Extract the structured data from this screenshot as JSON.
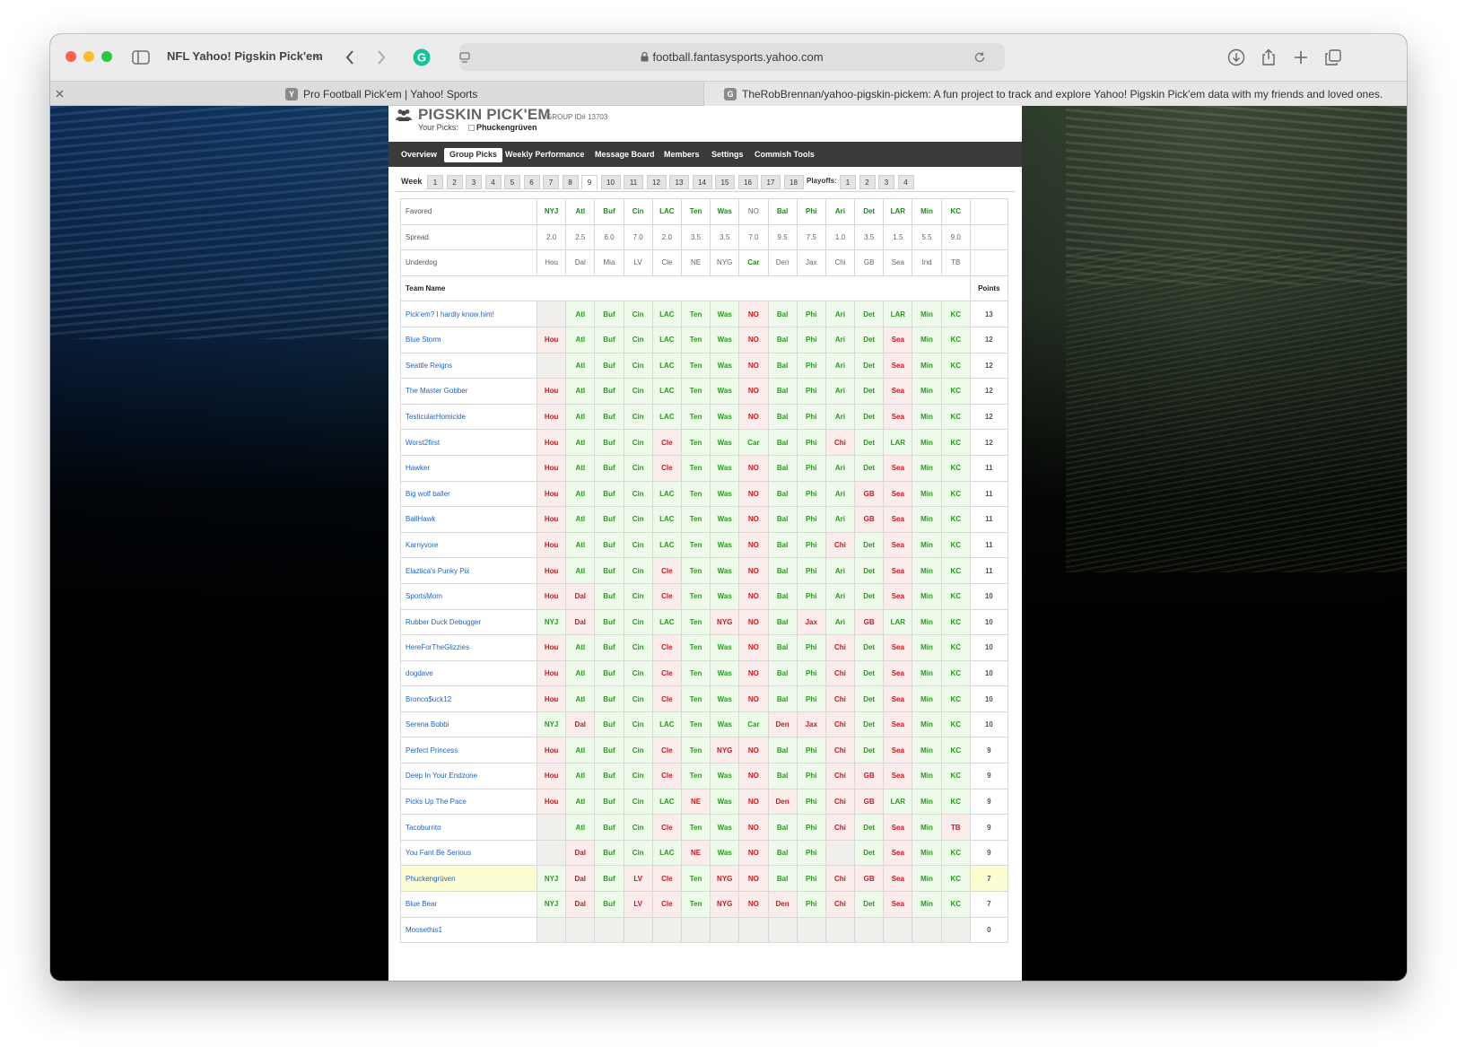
{
  "browser": {
    "window_title": "NFL Yahoo! Pigskin Pick'em",
    "url": "football.fantasysports.yahoo.com",
    "tabs": [
      {
        "favicon": "Y",
        "label": "Pro Football Pick'em | Yahoo! Sports"
      },
      {
        "favicon": "G",
        "label": "TheRobBrennan/yahoo-pigskin-pickem: A fun project to track and explore Yahoo! Pigskin Pick'em data with my friends and loved ones."
      }
    ]
  },
  "header": {
    "brand": "PIGSKIN PICK'EM",
    "group_id": "GROUP ID# 13703",
    "your_picks_label": "Your Picks:",
    "your_picks_value": "Phuckengrüven"
  },
  "nav": [
    "Overview",
    "Group Picks",
    "Weekly Performance",
    "Message Board",
    "Members",
    "Settings",
    "Commish Tools"
  ],
  "nav_active": "Group Picks",
  "weeks": {
    "label": "Week",
    "items": [
      "1",
      "2",
      "3",
      "4",
      "5",
      "6",
      "7",
      "8",
      "9",
      "10",
      "11",
      "12",
      "13",
      "14",
      "15",
      "16",
      "17",
      "18"
    ],
    "active": "9",
    "playoffs_label": "Playoffs:",
    "playoffs": [
      "1",
      "2",
      "3",
      "4"
    ]
  },
  "table": {
    "favored_label": "Favored",
    "spread_label": "Spread",
    "underdog_label": "Underdog",
    "team_name_label": "Team Name",
    "points_label": "Points",
    "favored": [
      "NYJ",
      "Atl",
      "Buf",
      "Cin",
      "LAC",
      "Ten",
      "Was",
      "NO",
      "Bal",
      "Phi",
      "Ari",
      "Det",
      "LAR",
      "Min",
      "KC"
    ],
    "spread": [
      "2.0",
      "2.5",
      "6.0",
      "7.0",
      "2.0",
      "3.5",
      "3.5",
      "7.0",
      "9.5",
      "7.5",
      "1.0",
      "3.5",
      "1.5",
      "5.5",
      "9.0"
    ],
    "underdog": [
      "Hou",
      "Dal",
      "Mia",
      "LV",
      "Cle",
      "NE",
      "NYG",
      "Car",
      "Den",
      "Jax",
      "Chi",
      "GB",
      "Sea",
      "Ind",
      "TB"
    ],
    "winners": [
      "NYJ",
      "Atl",
      "Buf",
      "Cin",
      "LAC",
      "Ten",
      "Was",
      "Car",
      "Bal",
      "Phi",
      "Ari",
      "Det",
      "LAR",
      "Min",
      "KC"
    ],
    "rows": [
      {
        "name": "Pick'em? I hardly know him!",
        "picks": [
          "",
          "Atl",
          "Buf",
          "Cin",
          "LAC",
          "Ten",
          "Was",
          "NO",
          "Bal",
          "Phi",
          "Ari",
          "Det",
          "LAR",
          "Min",
          "KC"
        ],
        "points": "13"
      },
      {
        "name": "Blue Storm",
        "picks": [
          "Hou",
          "Atl",
          "Buf",
          "Cin",
          "LAC",
          "Ten",
          "Was",
          "NO",
          "Bal",
          "Phi",
          "Ari",
          "Det",
          "Sea",
          "Min",
          "KC"
        ],
        "points": "12"
      },
      {
        "name": "Seattle Reigns",
        "picks": [
          "",
          "Atl",
          "Buf",
          "Cin",
          "LAC",
          "Ten",
          "Was",
          "NO",
          "Bal",
          "Phi",
          "Ari",
          "Det",
          "Sea",
          "Min",
          "KC"
        ],
        "points": "12"
      },
      {
        "name": "The Master Gobber",
        "picks": [
          "Hou",
          "Atl",
          "Buf",
          "Cin",
          "LAC",
          "Ten",
          "Was",
          "NO",
          "Bal",
          "Phi",
          "Ari",
          "Det",
          "Sea",
          "Min",
          "KC"
        ],
        "points": "12"
      },
      {
        "name": "TesticularHomicide",
        "picks": [
          "Hou",
          "Atl",
          "Buf",
          "Cin",
          "LAC",
          "Ten",
          "Was",
          "NO",
          "Bal",
          "Phi",
          "Ari",
          "Det",
          "Sea",
          "Min",
          "KC"
        ],
        "points": "12"
      },
      {
        "name": "Worst2first",
        "picks": [
          "Hou",
          "Atl",
          "Buf",
          "Cin",
          "Cle",
          "Ten",
          "Was",
          "Car",
          "Bal",
          "Phi",
          "Chi",
          "Det",
          "LAR",
          "Min",
          "KC"
        ],
        "points": "12"
      },
      {
        "name": "Hawker",
        "picks": [
          "Hou",
          "Atl",
          "Buf",
          "Cin",
          "Cle",
          "Ten",
          "Was",
          "NO",
          "Bal",
          "Phi",
          "Ari",
          "Det",
          "Sea",
          "Min",
          "KC"
        ],
        "points": "11"
      },
      {
        "name": "Big wolf baller",
        "picks": [
          "Hou",
          "Atl",
          "Buf",
          "Cin",
          "LAC",
          "Ten",
          "Was",
          "NO",
          "Bal",
          "Phi",
          "Ari",
          "GB",
          "Sea",
          "Min",
          "KC"
        ],
        "points": "11"
      },
      {
        "name": "BallHawk",
        "picks": [
          "Hou",
          "Atl",
          "Buf",
          "Cin",
          "LAC",
          "Ten",
          "Was",
          "NO",
          "Bal",
          "Phi",
          "Ari",
          "GB",
          "Sea",
          "Min",
          "KC"
        ],
        "points": "11"
      },
      {
        "name": "Karnyvore",
        "picks": [
          "Hou",
          "Atl",
          "Buf",
          "Cin",
          "LAC",
          "Ten",
          "Was",
          "NO",
          "Bal",
          "Phi",
          "Chi",
          "Det",
          "Sea",
          "Min",
          "KC"
        ],
        "points": "11"
      },
      {
        "name": "Elaztica's Punky Pix",
        "picks": [
          "Hou",
          "Atl",
          "Buf",
          "Cin",
          "Cle",
          "Ten",
          "Was",
          "NO",
          "Bal",
          "Phi",
          "Ari",
          "Det",
          "Sea",
          "Min",
          "KC"
        ],
        "points": "11"
      },
      {
        "name": "SportsMom",
        "picks": [
          "Hou",
          "Dal",
          "Buf",
          "Cin",
          "Cle",
          "Ten",
          "Was",
          "NO",
          "Bal",
          "Phi",
          "Ari",
          "Det",
          "Sea",
          "Min",
          "KC"
        ],
        "points": "10"
      },
      {
        "name": "Rubber Duck Debugger",
        "picks": [
          "NYJ",
          "Dal",
          "Buf",
          "Cin",
          "LAC",
          "Ten",
          "NYG",
          "NO",
          "Bal",
          "Jax",
          "Ari",
          "GB",
          "LAR",
          "Min",
          "KC"
        ],
        "points": "10"
      },
      {
        "name": "HereForTheGlizzies",
        "picks": [
          "Hou",
          "Atl",
          "Buf",
          "Cin",
          "Cle",
          "Ten",
          "Was",
          "NO",
          "Bal",
          "Phi",
          "Chi",
          "Det",
          "Sea",
          "Min",
          "KC"
        ],
        "points": "10"
      },
      {
        "name": "dogdave",
        "picks": [
          "Hou",
          "Atl",
          "Buf",
          "Cin",
          "Cle",
          "Ten",
          "Was",
          "NO",
          "Bal",
          "Phi",
          "Chi",
          "Det",
          "Sea",
          "Min",
          "KC"
        ],
        "points": "10"
      },
      {
        "name": "Bronco$uck12",
        "picks": [
          "Hou",
          "Atl",
          "Buf",
          "Cin",
          "Cle",
          "Ten",
          "Was",
          "NO",
          "Bal",
          "Phi",
          "Chi",
          "Det",
          "Sea",
          "Min",
          "KC"
        ],
        "points": "10"
      },
      {
        "name": "Serena Bobbi",
        "picks": [
          "NYJ",
          "Dal",
          "Buf",
          "Cin",
          "LAC",
          "Ten",
          "Was",
          "Car",
          "Den",
          "Jax",
          "Chi",
          "Det",
          "Sea",
          "Min",
          "KC"
        ],
        "points": "10"
      },
      {
        "name": "Perfect Princess",
        "picks": [
          "Hou",
          "Atl",
          "Buf",
          "Cin",
          "Cle",
          "Ten",
          "NYG",
          "NO",
          "Bal",
          "Phi",
          "Chi",
          "Det",
          "Sea",
          "Min",
          "KC"
        ],
        "points": "9"
      },
      {
        "name": "Deep In Your Endzone",
        "picks": [
          "Hou",
          "Atl",
          "Buf",
          "Cin",
          "Cle",
          "Ten",
          "Was",
          "NO",
          "Bal",
          "Phi",
          "Chi",
          "GB",
          "Sea",
          "Min",
          "KC"
        ],
        "points": "9"
      },
      {
        "name": "Picks Up The Pace",
        "picks": [
          "Hou",
          "Atl",
          "Buf",
          "Cin",
          "LAC",
          "NE",
          "Was",
          "NO",
          "Den",
          "Phi",
          "Chi",
          "GB",
          "LAR",
          "Min",
          "KC"
        ],
        "points": "9"
      },
      {
        "name": "Tacoburrito",
        "picks": [
          "",
          "Atl",
          "Buf",
          "Cin",
          "Cle",
          "Ten",
          "Was",
          "NO",
          "Bal",
          "Phi",
          "Chi",
          "Det",
          "Sea",
          "Min",
          "TB"
        ],
        "points": "9"
      },
      {
        "name": "You Fant Be Serious",
        "picks": [
          "",
          "Dal",
          "Buf",
          "Cin",
          "LAC",
          "NE",
          "Was",
          "NO",
          "Bal",
          "Phi",
          "",
          "Det",
          "Sea",
          "Min",
          "KC"
        ],
        "points": "9"
      },
      {
        "name": "Phuckengrüven",
        "picks": [
          "NYJ",
          "Dal",
          "Buf",
          "LV",
          "Cle",
          "Ten",
          "NYG",
          "NO",
          "Bal",
          "Phi",
          "Chi",
          "GB",
          "Sea",
          "Min",
          "KC"
        ],
        "points": "7",
        "highlight": true
      },
      {
        "name": "Blue Bear",
        "picks": [
          "NYJ",
          "Dal",
          "Buf",
          "LV",
          "Cle",
          "Ten",
          "NYG",
          "NO",
          "Den",
          "Phi",
          "Chi",
          "Det",
          "Sea",
          "Min",
          "KC"
        ],
        "points": "7"
      },
      {
        "name": "Moosethis1",
        "picks": [
          "",
          "",
          "",
          "",
          "",
          "",
          "",
          "",
          "",
          "",
          "",
          "",
          "",
          "",
          ""
        ],
        "points": "0"
      }
    ]
  }
}
